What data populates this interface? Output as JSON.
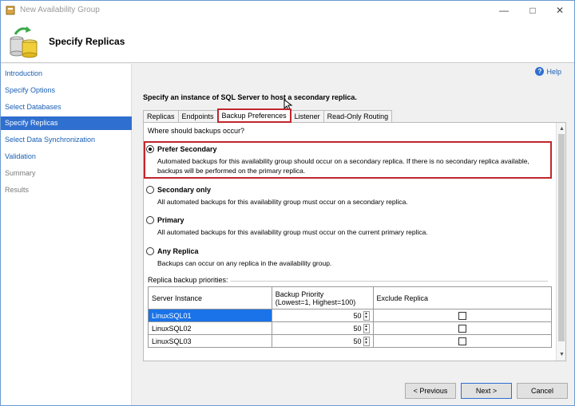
{
  "window": {
    "title": "New Availability Group"
  },
  "header": {
    "title": "Specify Replicas"
  },
  "nav": {
    "items": [
      {
        "label": "Introduction",
        "state": "link"
      },
      {
        "label": "Specify Options",
        "state": "link"
      },
      {
        "label": "Select Databases",
        "state": "link"
      },
      {
        "label": "Specify Replicas",
        "state": "active"
      },
      {
        "label": "Select Data Synchronization",
        "state": "link"
      },
      {
        "label": "Validation",
        "state": "link"
      },
      {
        "label": "Summary",
        "state": "disabled"
      },
      {
        "label": "Results",
        "state": "disabled"
      }
    ]
  },
  "main": {
    "help_label": "Help",
    "instruction": "Specify an instance of SQL Server to host a secondary replica.",
    "tabs": [
      {
        "label": "Replicas"
      },
      {
        "label": "Endpoints"
      },
      {
        "label": "Backup Preferences"
      },
      {
        "label": "Listener"
      },
      {
        "label": "Read-Only Routing"
      }
    ],
    "question": "Where should backups occur?",
    "options": [
      {
        "label": "Prefer Secondary",
        "desc": "Automated backups for this availability group should occur on a secondary replica. If there is no secondary replica available, backups will be performed on the primary replica.",
        "checked": true
      },
      {
        "label": "Secondary only",
        "desc": "All automated backups for this availability group must occur on a secondary replica.",
        "checked": false
      },
      {
        "label": "Primary",
        "desc": "All automated backups for this availability group must occur on the current primary replica.",
        "checked": false
      },
      {
        "label": "Any Replica",
        "desc": "Backups can occur on any replica in the availability group.",
        "checked": false
      }
    ],
    "priorities_label": "Replica backup priorities:",
    "table": {
      "headers": {
        "server": "Server Instance",
        "priority_line1": "Backup Priority",
        "priority_line2": "(Lowest=1, Highest=100)",
        "exclude": "Exclude Replica"
      },
      "rows": [
        {
          "server": "LinuxSQL01",
          "priority": "50",
          "exclude": false
        },
        {
          "server": "LinuxSQL02",
          "priority": "50",
          "exclude": false
        },
        {
          "server": "LinuxSQL03",
          "priority": "50",
          "exclude": false
        }
      ]
    }
  },
  "footer": {
    "previous": "< Previous",
    "next": "Next >",
    "cancel": "Cancel"
  },
  "colors": {
    "accent": "#2f6fcf",
    "highlight": "#c0262d",
    "selected_cell": "#1a73e8"
  },
  "icons": {
    "minimize": "minimize-icon",
    "maximize": "maximize-icon",
    "close": "close-icon",
    "help": "help-icon",
    "database": "database-icon"
  }
}
